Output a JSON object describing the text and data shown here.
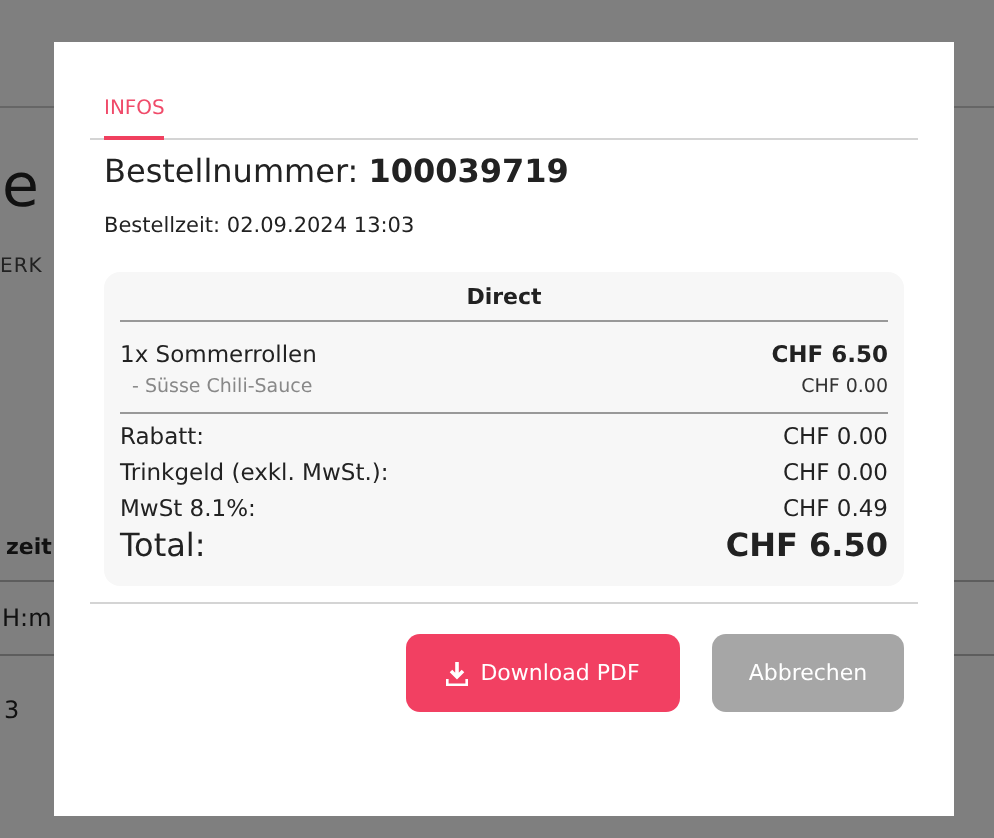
{
  "background": {
    "heading": "e",
    "tab": "ERK",
    "column": "zeit",
    "input_placeholder": "H:m",
    "cell": "3"
  },
  "modal": {
    "tabs": [
      {
        "label": "INFOS",
        "selected": true
      }
    ],
    "order_label": "Bestellnummer:",
    "order_number": "100039719",
    "order_time": "Bestellzeit: 02.09.2024 13:03",
    "receipt": {
      "title": "Direct",
      "items": [
        {
          "name": "1x Sommerrollen",
          "price": "CHF 6.50",
          "kind": "item"
        },
        {
          "name": "- Süsse Chili-Sauce",
          "price": "CHF 0.00",
          "kind": "modifier"
        }
      ],
      "summary": [
        {
          "label": "Rabatt:",
          "value": "CHF 0.00"
        },
        {
          "label": "Trinkgeld (exkl. MwSt.):",
          "value": "CHF 0.00"
        },
        {
          "label": "MwSt 8.1%:",
          "value": "CHF 0.49"
        }
      ],
      "total_label": "Total:",
      "total_value": "CHF 6.50"
    },
    "buttons": [
      {
        "label": "Download PDF",
        "kind": "primary"
      },
      {
        "label": "Abbrechen",
        "kind": "secondary"
      }
    ]
  }
}
